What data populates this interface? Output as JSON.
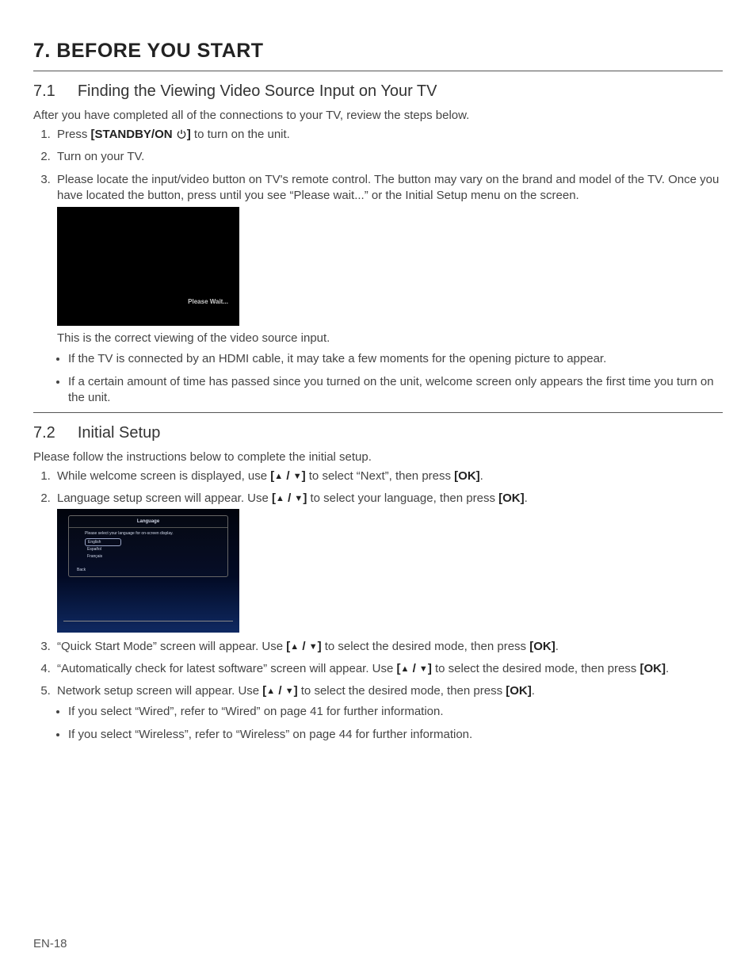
{
  "chapter": {
    "number": "7.",
    "title": "BEFORE YOU START"
  },
  "section71": {
    "num": "7.1",
    "title": "Finding the Viewing Video Source Input on Your TV",
    "lead": "After you have completed all of the connections to your TV, review the steps below.",
    "step1_a": "Press ",
    "step1_b": "[STANDBY/ON ",
    "step1_c": "]",
    "step1_d": " to turn on the unit.",
    "step2": "Turn on your TV.",
    "step3": "Please locate the input/video button on TV's remote control.  The button may vary on the brand and model of the TV.  Once you have located the button, press until you see “Please wait...” or the Initial Setup menu on the screen.",
    "tv_wait_msg": "Please Wait...",
    "caption": "This is the correct viewing of the video source input.",
    "bullet1": "If the TV is connected by an HDMI cable, it may take a few moments for the opening picture to appear.",
    "bullet2": "If a certain amount of time has passed since you turned on the unit, welcome screen only appears the first time you turn on the unit."
  },
  "section72": {
    "num": "7.2",
    "title": "Initial Setup",
    "lead": "Please follow the instructions below to complete the initial setup.",
    "s1_a": "While welcome screen is displayed, use ",
    "s1_b": " to select “Next”, then press ",
    "s1_ok": "[OK]",
    "s1_c": ".",
    "s2_a": "Language setup screen will appear. Use ",
    "s2_b": " to select your language, then press ",
    "s2_ok": "[OK]",
    "s2_c": ".",
    "dlg_title": "Language",
    "dlg_prompt": "Please select your language for on-screen display.",
    "dlg_opt1": "English",
    "dlg_opt2": "Español",
    "dlg_opt3": "Français",
    "dlg_back": "Back",
    "s3_a": "“Quick Start Mode” screen will appear. Use ",
    "s3_b": " to select the desired mode, then press ",
    "s3_ok": "[OK]",
    "s3_c": ".",
    "s4_a": "“Automatically check for latest software” screen will appear. Use ",
    "s4_b": " to select the desired mode, then press ",
    "s4_ok": "[OK]",
    "s4_c": ".",
    "s5_a": "Network setup screen will appear. Use ",
    "s5_b": " to select the desired mode, then press ",
    "s5_ok": "[OK]",
    "s5_c": ".",
    "s5_sub1": "If you select “Wired”, refer to “Wired” on page 41 for further information.",
    "s5_sub2": "If you select “Wireless”, refer to “Wireless” on page 44 for further information."
  },
  "symbols": {
    "bracket_open": "[",
    "bracket_close": "]",
    "slash": " / "
  },
  "pagenum": "EN-18"
}
